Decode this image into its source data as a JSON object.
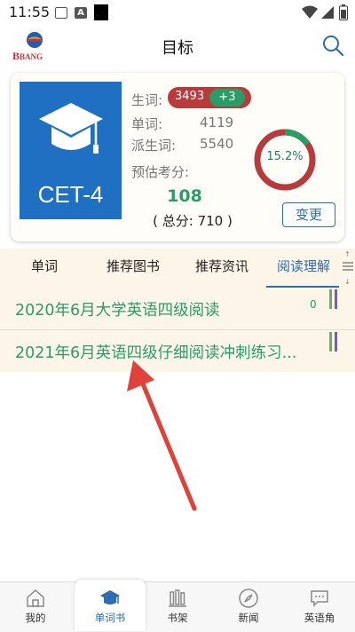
{
  "status": {
    "time": "11:55"
  },
  "header": {
    "title": "目标",
    "logo_text": "BANG"
  },
  "card": {
    "book_label": "CET-4",
    "new_words_label": "生词:",
    "new_words_count": "3493",
    "new_words_increment": "+3",
    "words_label": "单词:",
    "words_count": "4119",
    "derived_label": "派生词:",
    "derived_count": "5540",
    "estimate_label": "预估考分:",
    "estimate_score": "108",
    "total_text": "( 总分: 710 )",
    "progress_text": "15.2%",
    "progress_fraction": 0.152,
    "change_button": "变更"
  },
  "tabs": [
    {
      "label": "单词"
    },
    {
      "label": "推荐图书"
    },
    {
      "label": "推荐资讯"
    },
    {
      "label": "阅读理解"
    }
  ],
  "list": [
    {
      "title": "2020年6月大学英语四级阅读",
      "count": "0"
    },
    {
      "title": "2021年6月英语四级仔细阅读冲刺练习..."
    }
  ],
  "nav": [
    {
      "label": "我的",
      "icon": "home-icon"
    },
    {
      "label": "单词书",
      "icon": "mortarboard-icon"
    },
    {
      "label": "书架",
      "icon": "bookshelf-icon"
    },
    {
      "label": "新闻",
      "icon": "compass-icon"
    },
    {
      "label": "英语角",
      "icon": "chat-icon"
    }
  ],
  "colors": {
    "accent": "#2d6bb5",
    "green": "#2a9d66",
    "red": "#b83a3a",
    "tab_bg": "#fdf6e8"
  }
}
